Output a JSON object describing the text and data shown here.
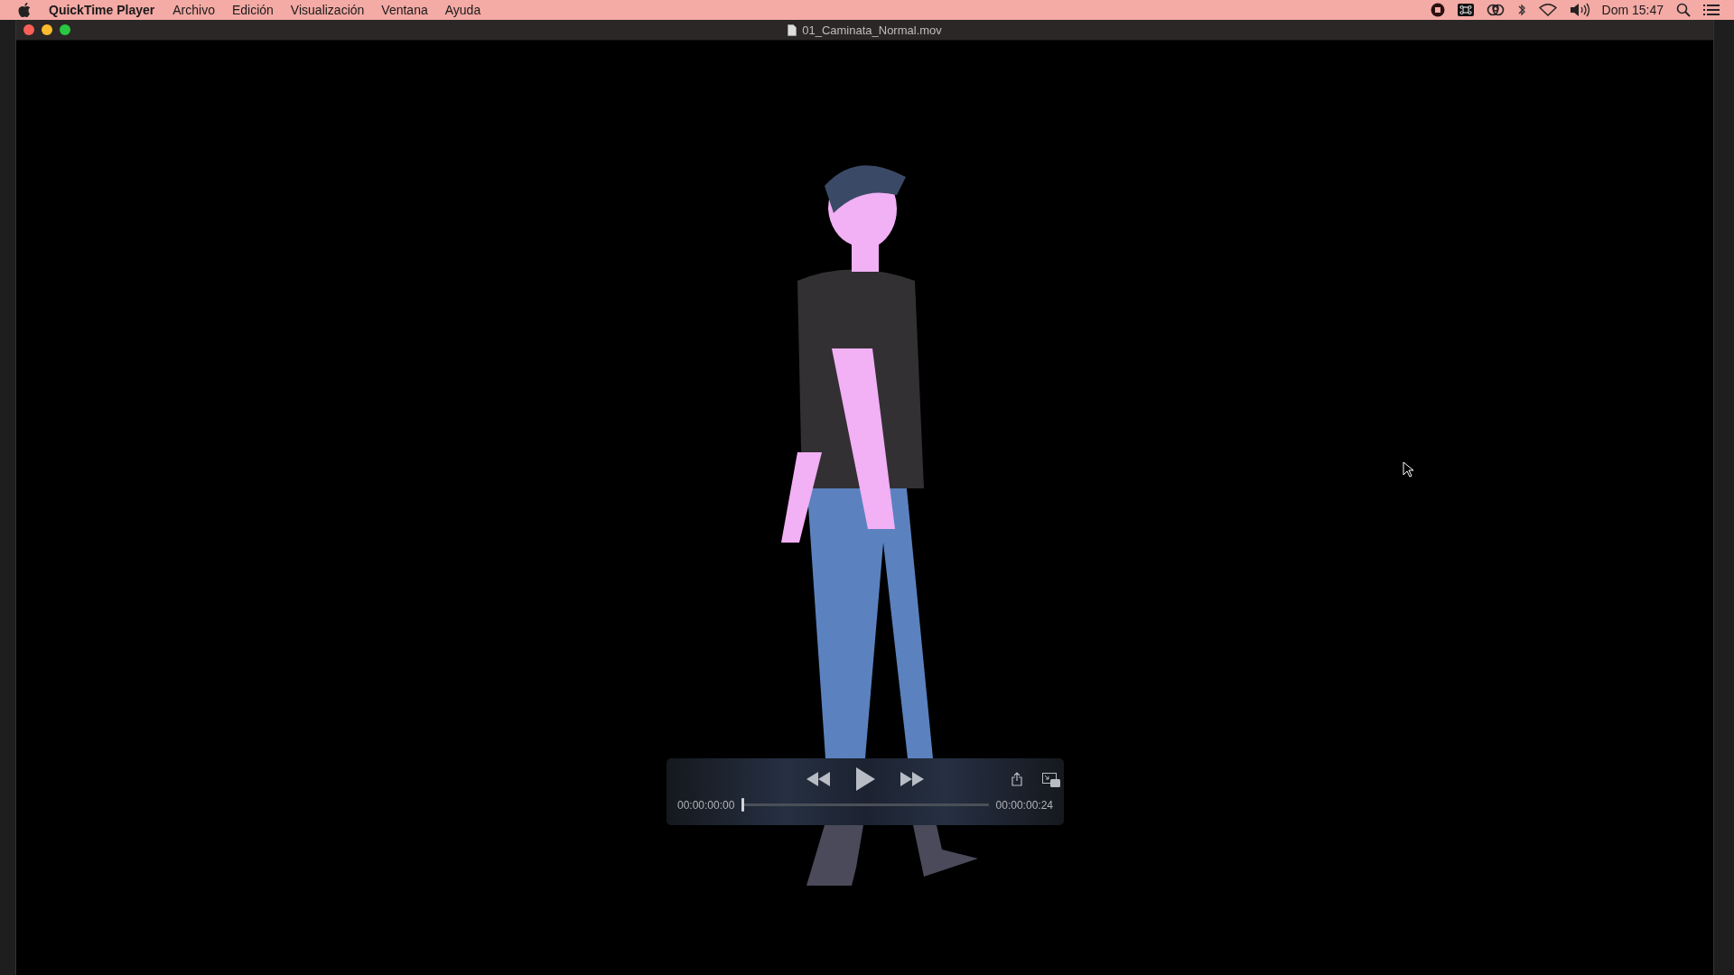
{
  "menu_bar": {
    "app_name": "QuickTime Player",
    "items": [
      "Archivo",
      "Edición",
      "Visualización",
      "Ventana",
      "Ayuda"
    ],
    "clock": "Dom 15:47"
  },
  "window": {
    "title": "01_Caminata_Normal.mov"
  },
  "player": {
    "playing": false,
    "current_time": "00:00:00:00",
    "end_time": "00:00:00:24",
    "progress": {
      "level": 0
    }
  }
}
